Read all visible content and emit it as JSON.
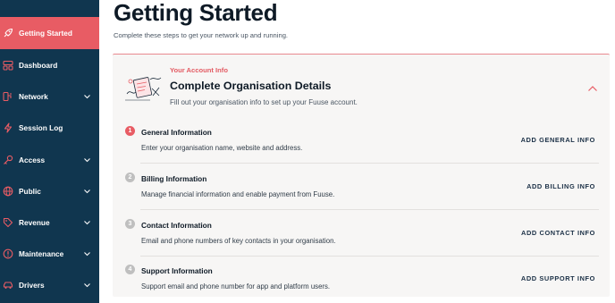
{
  "sidebar": {
    "items": [
      {
        "label": "Getting Started",
        "icon": "rocket-icon",
        "active": true,
        "chevron": false
      },
      {
        "label": "Dashboard",
        "icon": "dashboard-icon",
        "active": false,
        "chevron": false
      },
      {
        "label": "Network",
        "icon": "network-icon",
        "active": false,
        "chevron": true
      },
      {
        "label": "Session Log",
        "icon": "lightning-icon",
        "active": false,
        "chevron": false
      },
      {
        "label": "Access",
        "icon": "key-icon",
        "active": false,
        "chevron": true
      },
      {
        "label": "Public",
        "icon": "globe-icon",
        "active": false,
        "chevron": true
      },
      {
        "label": "Revenue",
        "icon": "tag-icon",
        "active": false,
        "chevron": true
      },
      {
        "label": "Maintenance",
        "icon": "alert-circle-icon",
        "active": false,
        "chevron": true
      },
      {
        "label": "Drivers",
        "icon": "car-icon",
        "active": false,
        "chevron": true
      }
    ]
  },
  "main": {
    "title": "Getting Started",
    "subtitle": "Complete these steps to get your network up and running."
  },
  "card": {
    "eyebrow": "Your Account Info",
    "title": "Complete Organisation Details",
    "description": "Fill out your organisation info to set up your Fuuse account.",
    "steps": [
      {
        "number": "1",
        "title": "General Information",
        "description": "Enter your organisation name, website and address.",
        "action": "ADD GENERAL INFO",
        "active": true
      },
      {
        "number": "2",
        "title": "Billing Information",
        "description": "Manage financial information and enable payment from Fuuse.",
        "action": "ADD BILLING INFO",
        "active": false
      },
      {
        "number": "3",
        "title": "Contact Information",
        "description": "Email and phone numbers of key contacts in your organisation.",
        "action": "ADD CONTACT INFO",
        "active": false
      },
      {
        "number": "4",
        "title": "Support Information",
        "description": "Support email and phone number for app and platform users.",
        "action": "ADD SUPPORT INFO",
        "active": false
      }
    ]
  },
  "colors": {
    "sidebar_bg": "#10364f",
    "accent": "#e85c64",
    "card_bg": "#f7f6f5"
  }
}
